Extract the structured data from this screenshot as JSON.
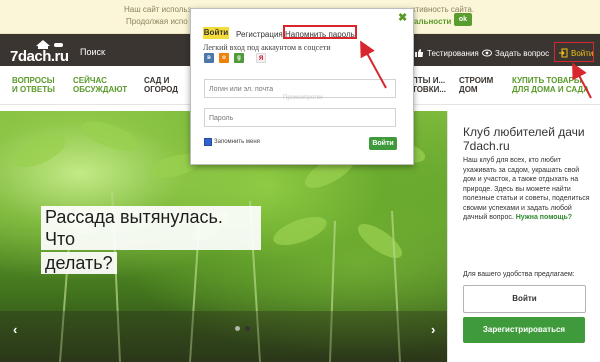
{
  "cookie_bar": {
    "line1_left": "Наш сайт использ",
    "line1_right": "ктивность сайта.",
    "line2_left": "Продолжая испо",
    "line2_link": "альности",
    "ok_label": "ok"
  },
  "header": {
    "logo_text": "7dach.ru",
    "search_label": "Поиск:",
    "tests_label": "Тестирования",
    "ask_label": "Задать вопрос",
    "login_label": "Войти"
  },
  "nav": {
    "items": [
      {
        "line1": "Вопросы",
        "line2": "и ответы"
      },
      {
        "line1": "Сейчас",
        "line2": "обсуждают"
      },
      {
        "line1": "Сад и",
        "line2": "огород"
      },
      {
        "line1": "...пты и",
        "line2": "...отовки"
      },
      {
        "line1": "Строим",
        "line2": "дом"
      },
      {
        "line1": "Купить товары",
        "line2": "для дома и сада"
      }
    ]
  },
  "hero": {
    "title_line1": "Рассада вытянулась. Что",
    "title_line2": "делать?",
    "prev_arrow": "‹",
    "next_arrow": "›"
  },
  "sidebar": {
    "title": "Клуб любителей дачи 7dach.ru",
    "text": "Наш клуб для всех, кто любит ухаживать за садом, украшать свой дом и участок, а также отдыхать на природе. Здесь вы можете найти полезные статьи и советы, поделиться своими успехами и задать любой дачный вопрос.",
    "help_link": "Нужна помощь?",
    "offer_text": "Для вашего удобства предлагаем:",
    "login_button": "Войти",
    "register_button": "Зарегистрироваться"
  },
  "popup": {
    "tab_login": "Войти",
    "tab_register": "Регистрация",
    "tab_remind": "Напомнить пароль",
    "social_title": "Легкий вход под аккаунтом в соцсети",
    "social": [
      {
        "icon": "vk-icon",
        "label": "в",
        "color": "#4a76a8"
      },
      {
        "icon": "ok-icon",
        "label": "о",
        "color": "#ee8208"
      },
      {
        "icon": "google-icon",
        "label": "g",
        "color": "#4f9a3a"
      },
      {
        "icon": "yandex-icon",
        "label": "Я",
        "color": "#f2f2f2",
        "text_color": "#d0021b"
      }
    ],
    "login_placeholder": "Логин или эл. почта",
    "password_placeholder": "Пароль",
    "ghost_text": "Промокпротки",
    "remember_label": "Запомнить меня",
    "enter_button": "Войти",
    "close_symbol": "✖"
  }
}
